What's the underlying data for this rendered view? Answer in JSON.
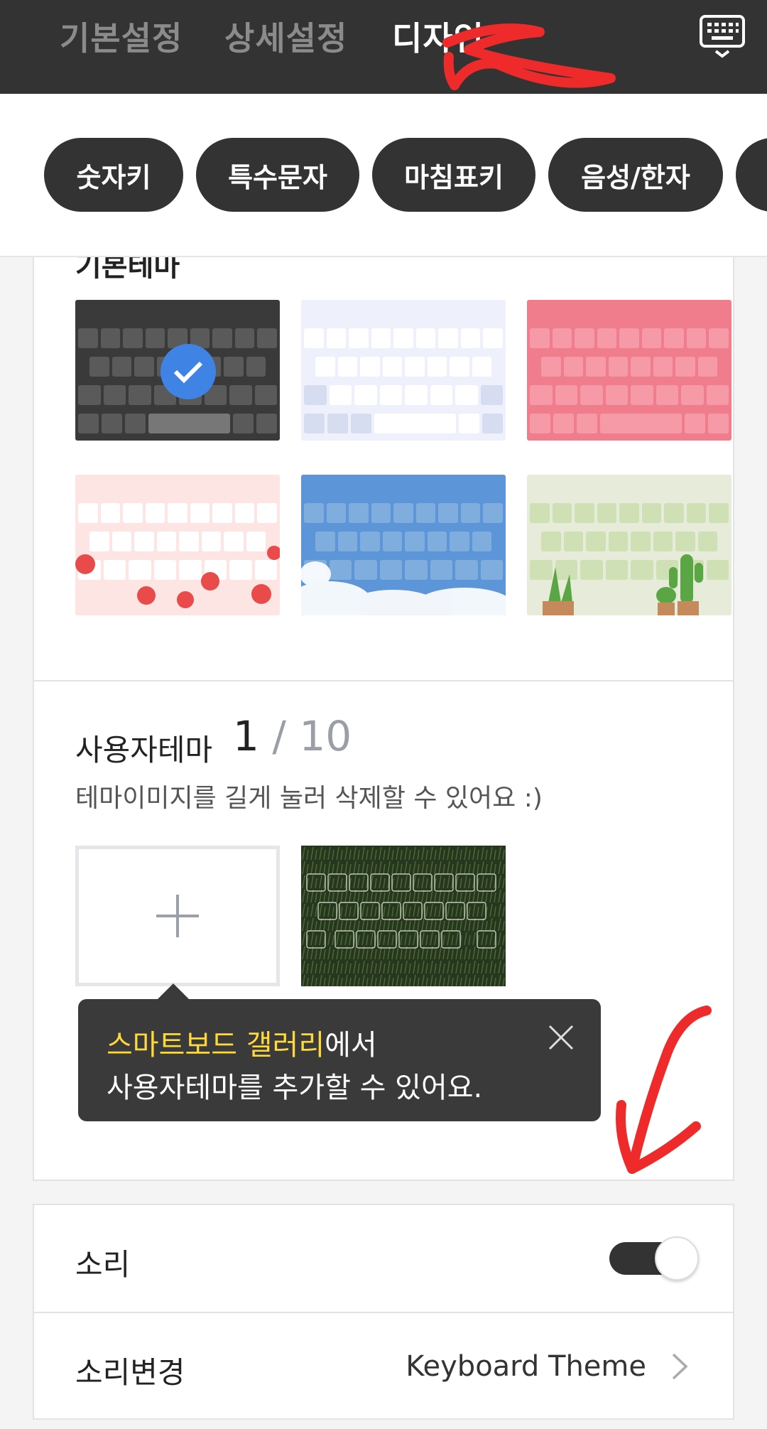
{
  "top_tabs": [
    {
      "label": "기본설정",
      "active": false
    },
    {
      "label": "상세설정",
      "active": false
    },
    {
      "label": "디자인",
      "active": true
    }
  ],
  "chips": [
    "숫자키",
    "특수문자",
    "마침표키",
    "음성/한자"
  ],
  "theme_section": {
    "partial_title": "기본테마",
    "selected_index": 0
  },
  "user_theme": {
    "title": "사용자테마",
    "count_current": "1",
    "count_sep": "/",
    "count_max": "10",
    "hint": "테마이미지를 길게 눌러 삭제할 수 있어요 :)"
  },
  "tooltip": {
    "highlight": "스마트보드 갤러리",
    "line1_rest": "에서",
    "line2": "사용자테마를 추가할 수 있어요."
  },
  "settings": {
    "sound_label": "소리",
    "sound_on": true,
    "sound_change_label": "소리변경",
    "sound_change_value": "Keyboard Theme"
  },
  "colors": {
    "dark": "#333333",
    "accent_blue": "#3f84e5",
    "highlight_yellow": "#ffd83a",
    "annotation_red": "#ee2a2a"
  }
}
